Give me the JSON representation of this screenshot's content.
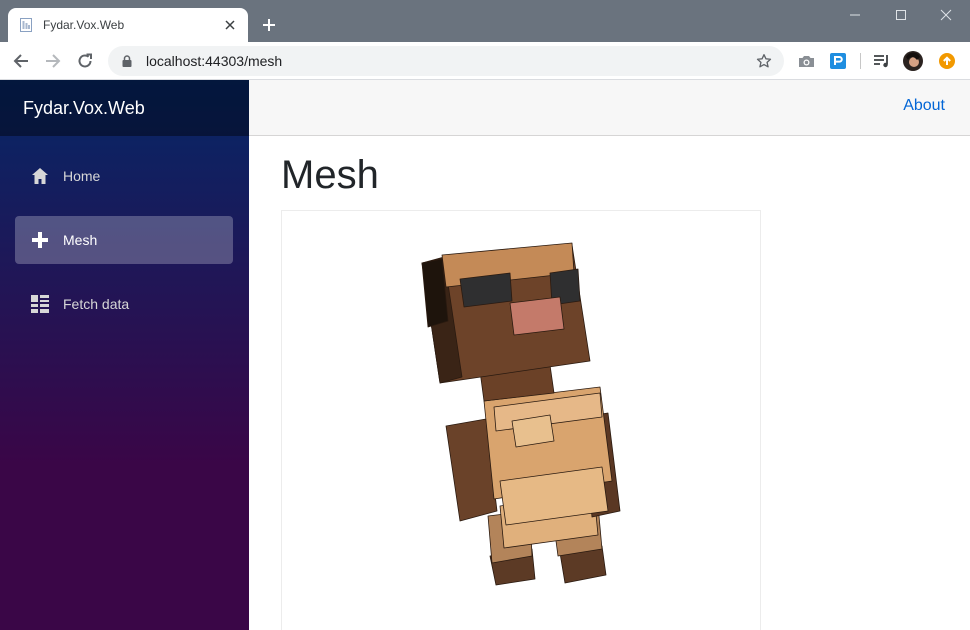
{
  "browser": {
    "tab_title": "Fydar.Vox.Web",
    "url": "localhost:44303/mesh"
  },
  "app": {
    "brand": "Fydar.Vox.Web",
    "nav": [
      {
        "label": "Home",
        "icon": "home-icon",
        "active": false
      },
      {
        "label": "Mesh",
        "icon": "plus-icon",
        "active": true
      },
      {
        "label": "Fetch data",
        "icon": "list-icon",
        "active": false
      }
    ],
    "top_link": "About",
    "page_title": "Mesh"
  },
  "colors": {
    "sidebar_start": "#052767",
    "sidebar_end": "#3a0647",
    "link": "#0366d6"
  }
}
